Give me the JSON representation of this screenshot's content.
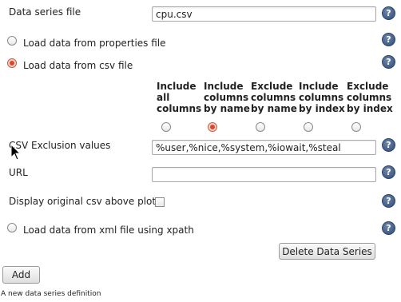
{
  "series_file": {
    "label": "Data series file",
    "value": "cpu.csv"
  },
  "load_properties": {
    "label": "Load data from properties file",
    "checked": false
  },
  "load_csv": {
    "label": "Load data from csv file",
    "checked": true
  },
  "csv_modes": [
    {
      "label": "Include\nall\ncolumns",
      "checked": false
    },
    {
      "label": "Include\ncolumns\nby name",
      "checked": true
    },
    {
      "label": "Exclude\ncolumns\nby name",
      "checked": false
    },
    {
      "label": "Include\ncolumns\nby index",
      "checked": false
    },
    {
      "label": "Exclude\ncolumns\nby index",
      "checked": false
    }
  ],
  "csv_exclusion": {
    "label": "CSV Exclusion values",
    "value": "%user,%nice,%system,%iowait,%steal"
  },
  "url": {
    "label": "URL",
    "value": ""
  },
  "display_original": {
    "label": "Display original csv above plot",
    "checked": false
  },
  "load_xml": {
    "label": "Load data from xml file using xpath",
    "checked": false
  },
  "help_glyph": "?",
  "delete_button": {
    "label": "Delete Data Series"
  },
  "add_button": {
    "label": "Add"
  },
  "caption": "A new data series definition"
}
